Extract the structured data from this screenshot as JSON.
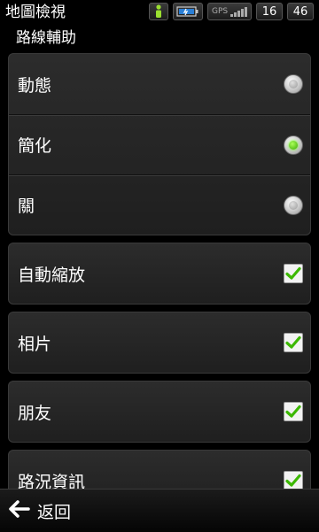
{
  "status_bar": {
    "app_title": "地圖檢視",
    "gps_label": "GPS",
    "clock_hour": "16",
    "clock_minute": "46"
  },
  "section_header": "路線輔助",
  "route_assist_options": [
    {
      "label": "動態",
      "selected": false
    },
    {
      "label": "簡化",
      "selected": true
    },
    {
      "label": "關",
      "selected": false
    }
  ],
  "settings": [
    {
      "label": "自動縮放",
      "checked": true
    },
    {
      "label": "相片",
      "checked": true
    },
    {
      "label": "朋友",
      "checked": true
    },
    {
      "label": "路況資訊",
      "checked": true
    }
  ],
  "bottom_bar": {
    "back_label": "返回"
  },
  "colors": {
    "check_green": "#3cb800",
    "radio_on": "#5cff00",
    "background": "#000000"
  }
}
